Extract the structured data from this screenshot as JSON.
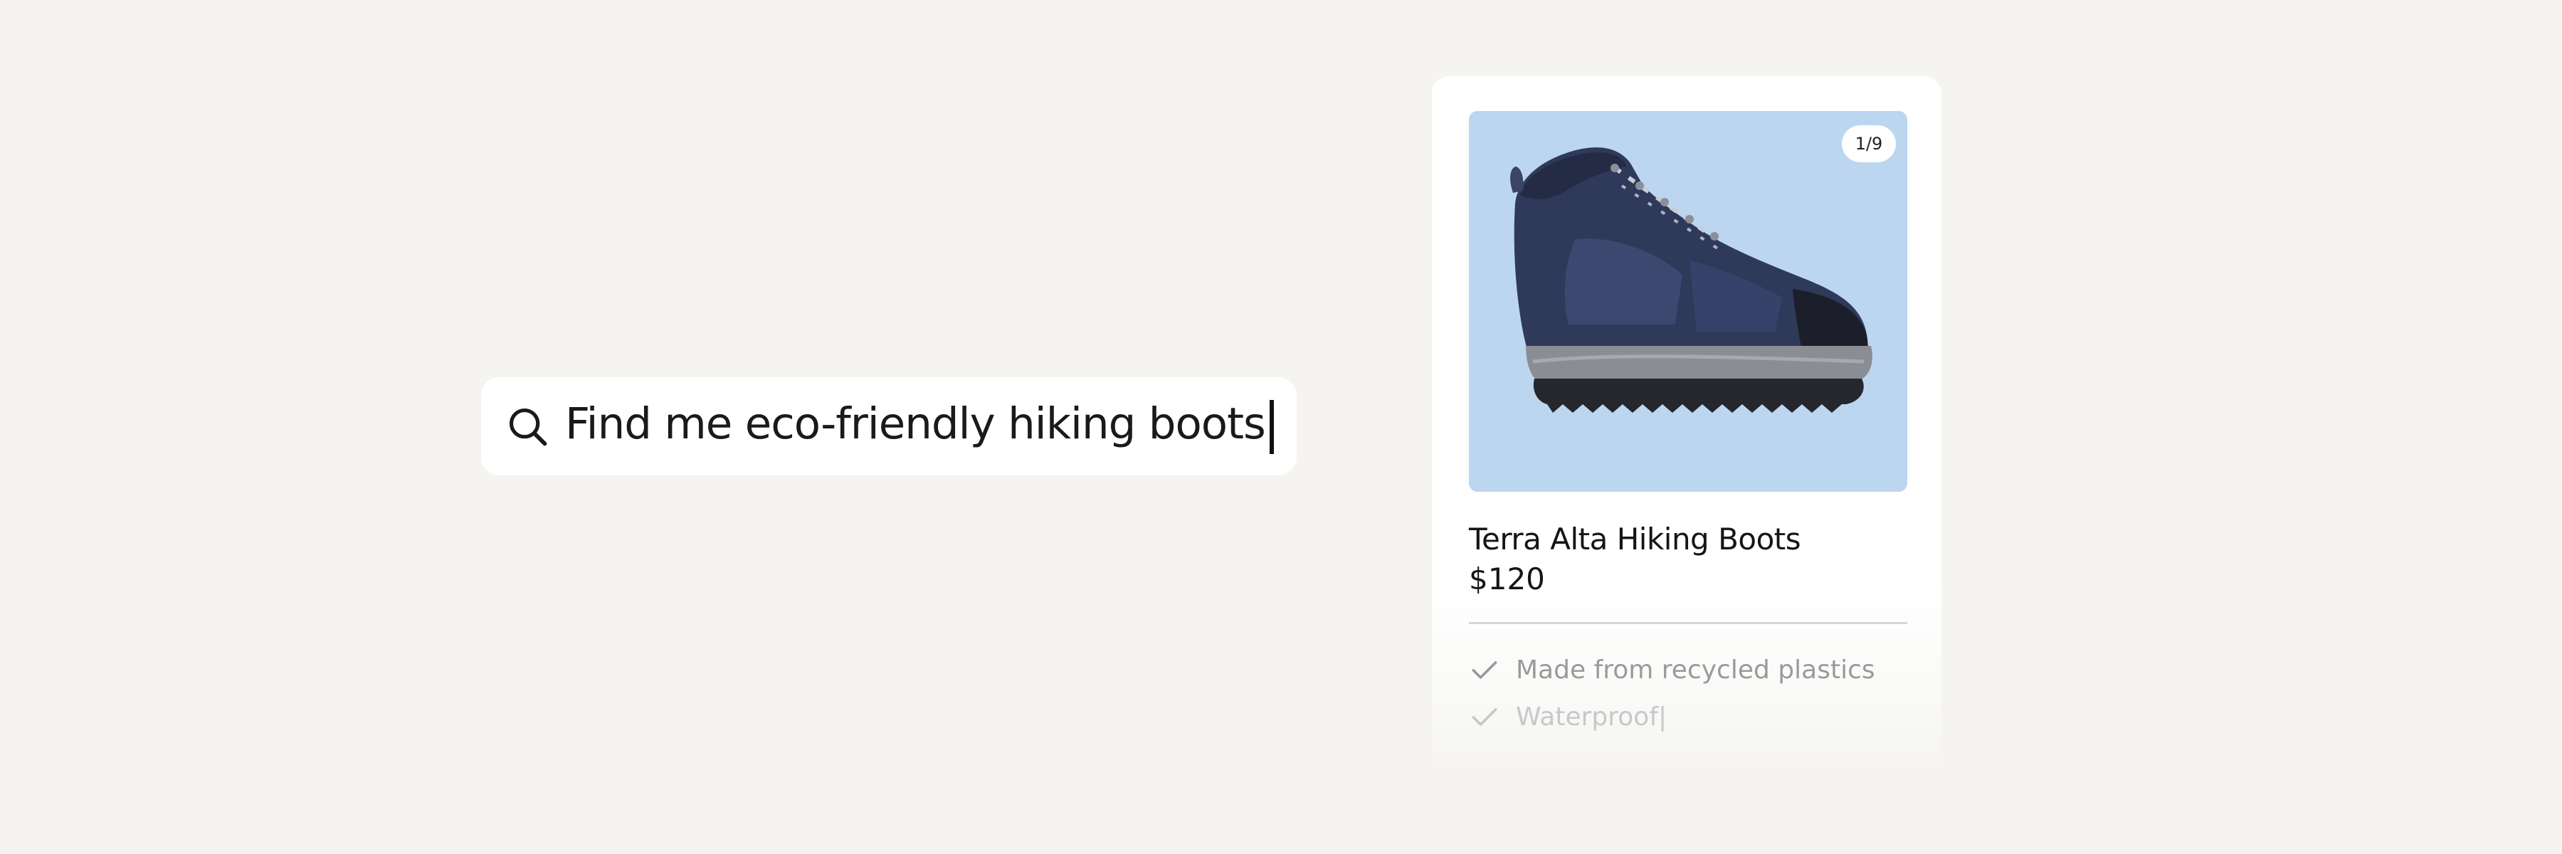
{
  "search": {
    "query": "Find me eco-friendly hiking boots",
    "icon": "search-icon"
  },
  "product": {
    "image_counter": "1/9",
    "title": "Terra Alta Hiking Boots",
    "price": "$120",
    "features": [
      {
        "label": "Made from recycled plastics",
        "icon": "check-icon"
      },
      {
        "label": "Waterproof|",
        "icon": "check-icon"
      }
    ]
  },
  "colors": {
    "background": "#f5f4f1",
    "image_background": "#bcd6f0",
    "boot_primary": "#2f3a5a"
  }
}
